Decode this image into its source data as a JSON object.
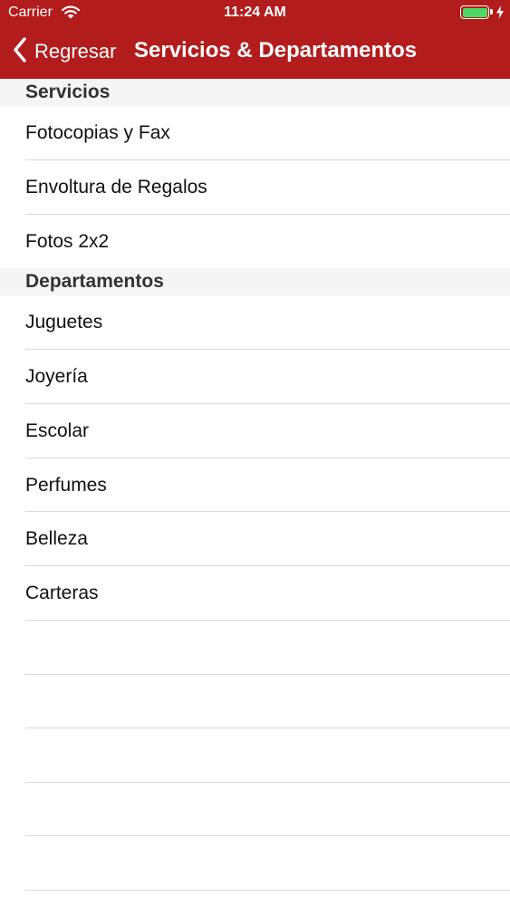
{
  "status_bar": {
    "carrier": "Carrier",
    "time": "11:24 AM",
    "battery_level": 1.0,
    "battery_color": "#4cd964",
    "charging": true,
    "wifi_icon": "wifi-icon"
  },
  "nav": {
    "background": "#b31c1c",
    "back_label": "Regresar",
    "back_icon": "chevron-left-icon",
    "title": "Servicios & Departamentos"
  },
  "sections": [
    {
      "header": "Servicios",
      "items": [
        "Fotocopias y Fax",
        "Envoltura de Regalos",
        "Fotos 2x2"
      ]
    },
    {
      "header": "Departamentos",
      "items": [
        "Juguetes",
        "Joyería",
        "Escolar",
        "Perfumes",
        "Belleza",
        "Carteras"
      ]
    }
  ]
}
